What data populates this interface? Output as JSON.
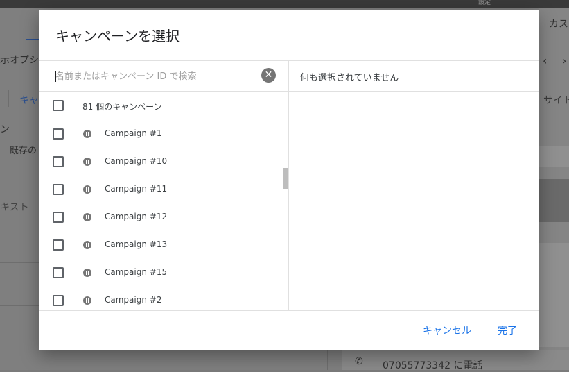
{
  "background": {
    "top_label": "設定",
    "tab_right": "カス",
    "left_texts": [
      "示オプシ",
      "キャ",
      "ン",
      "既存の",
      "キスト"
    ],
    "right_text": "サイト",
    "phone_text": "07055773342 に電話",
    "phone_icon": "phone-icon"
  },
  "dialog": {
    "title": "キャンペーンを選択",
    "search": {
      "placeholder": "名前またはキャンペーン ID で検索",
      "value": "",
      "clear_icon": "clear-icon"
    },
    "selected_panel": {
      "empty_text": "何も選択されていません"
    },
    "list_header": {
      "label": "81 個のキャンペーン",
      "checked": false
    },
    "campaigns": [
      {
        "name": "Campaign #1",
        "status_icon": "pause-icon",
        "checked": false
      },
      {
        "name": "Campaign #10",
        "status_icon": "pause-icon",
        "checked": false
      },
      {
        "name": "Campaign #11",
        "status_icon": "pause-icon",
        "checked": false
      },
      {
        "name": "Campaign #12",
        "status_icon": "pause-icon",
        "checked": false
      },
      {
        "name": "Campaign #13",
        "status_icon": "pause-icon",
        "checked": false
      },
      {
        "name": "Campaign #15",
        "status_icon": "pause-icon",
        "checked": false
      },
      {
        "name": "Campaign #2",
        "status_icon": "pause-icon",
        "checked": false
      }
    ],
    "buttons": {
      "cancel": "キャンセル",
      "done": "完了"
    },
    "colors": {
      "accent": "#1a73e8",
      "icon_gray": "#757575"
    }
  }
}
